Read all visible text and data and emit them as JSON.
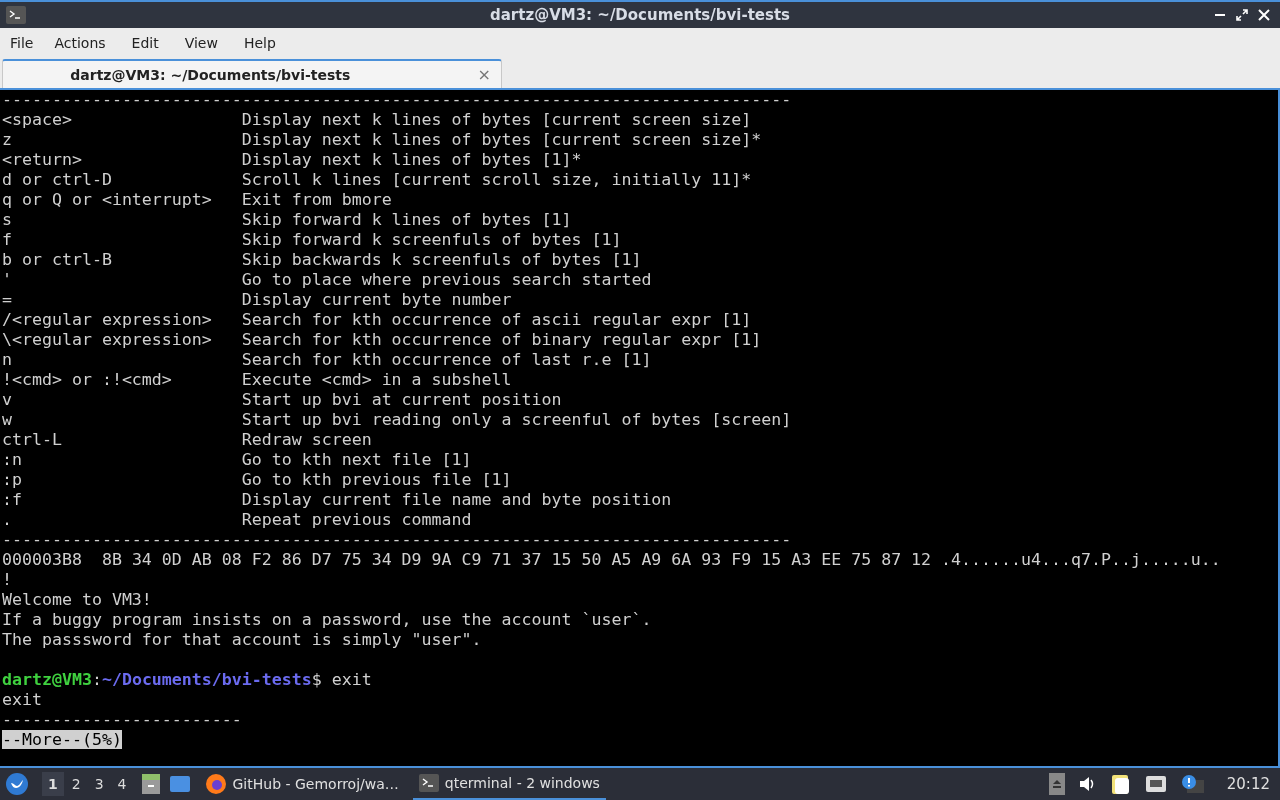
{
  "window": {
    "title": "dartz@VM3: ~/Documents/bvi-tests"
  },
  "menu": [
    "File",
    "Actions",
    "Edit",
    "View",
    "Help"
  ],
  "tabs": [
    {
      "label": "dartz@VM3: ~/Documents/bvi-tests",
      "selected": true,
      "close": "×"
    }
  ],
  "terminal": {
    "lines": [
      {
        "kind": "rule",
        "text": "-------------------------------------------------------------------------------"
      },
      {
        "kind": "help",
        "key": "<space>",
        "desc": "Display next k lines of bytes [current screen size]"
      },
      {
        "kind": "help",
        "key": "z",
        "desc": "Display next k lines of bytes [current screen size]*"
      },
      {
        "kind": "help",
        "key": "<return>",
        "desc": "Display next k lines of bytes [1]*"
      },
      {
        "kind": "help",
        "key": "d or ctrl-D",
        "desc": "Scroll k lines [current scroll size, initially 11]*"
      },
      {
        "kind": "help",
        "key": "q or Q or <interrupt>",
        "desc": "Exit from bmore"
      },
      {
        "kind": "help",
        "key": "s",
        "desc": "Skip forward k lines of bytes [1]"
      },
      {
        "kind": "help",
        "key": "f",
        "desc": "Skip forward k screenfuls of bytes [1]"
      },
      {
        "kind": "help",
        "key": "b or ctrl-B",
        "desc": "Skip backwards k screenfuls of bytes [1]"
      },
      {
        "kind": "help",
        "key": "'",
        "desc": "Go to place where previous search started"
      },
      {
        "kind": "help",
        "key": "=",
        "desc": "Display current byte number"
      },
      {
        "kind": "help",
        "key": "/<regular expression>",
        "desc": "Search for kth occurrence of ascii regular expr [1]"
      },
      {
        "kind": "help",
        "key": "\\<regular expression>",
        "desc": "Search for kth occurrence of binary regular expr [1]"
      },
      {
        "kind": "help",
        "key": "n",
        "desc": "Search for kth occurrence of last r.e [1]"
      },
      {
        "kind": "help",
        "key": "!<cmd> or :!<cmd>",
        "desc": "Execute <cmd> in a subshell"
      },
      {
        "kind": "help",
        "key": "v",
        "desc": "Start up bvi at current position"
      },
      {
        "kind": "help",
        "key": "w",
        "desc": "Start up bvi reading only a screenful of bytes [screen]"
      },
      {
        "kind": "help",
        "key": "ctrl-L",
        "desc": "Redraw screen"
      },
      {
        "kind": "help",
        "key": ":n",
        "desc": "Go to kth next file [1]"
      },
      {
        "kind": "help",
        "key": ":p",
        "desc": "Go to kth previous file [1]"
      },
      {
        "kind": "help",
        "key": ":f",
        "desc": "Display current file name and byte position"
      },
      {
        "kind": "help",
        "key": ".",
        "desc": "Repeat previous command"
      },
      {
        "kind": "rule",
        "text": "-------------------------------------------------------------------------------"
      },
      {
        "kind": "hex",
        "address": "000003B8",
        "bytes": "8B 34 0D AB 08 F2 86 D7 75 34 D9 9A C9 71 37 15 50 A5 A9 6A 93 F9 15 A3 EE 75 87 12",
        "ascii": ".4......u4...q7.P..j.....u.."
      },
      {
        "kind": "text",
        "text": "!"
      },
      {
        "kind": "text",
        "text": "Welcome to VM3!"
      },
      {
        "kind": "text",
        "text": "If a buggy program insists on a password, use the account `user`."
      },
      {
        "kind": "text",
        "text": "The passsword for that account is simply \"user\"."
      },
      {
        "kind": "blank"
      },
      {
        "kind": "prompt",
        "user": "dartz@VM3",
        "sep": ":",
        "path": "~/Documents/bvi-tests",
        "command": "$ exit"
      },
      {
        "kind": "text",
        "text": "exit"
      },
      {
        "kind": "rule",
        "text": "------------------------"
      },
      {
        "kind": "more",
        "text": "--More--(5%)"
      }
    ]
  },
  "taskbar": {
    "workspaces": [
      {
        "label": "1",
        "selected": true
      },
      {
        "label": "2",
        "selected": false
      },
      {
        "label": "3",
        "selected": false
      },
      {
        "label": "4",
        "selected": false
      }
    ],
    "tasks": [
      {
        "kind": "browser",
        "label": "GitHub - Gemorroj/wa…",
        "selected": false
      },
      {
        "kind": "terminal",
        "label": "qterminal - 2 windows",
        "selected": true
      }
    ],
    "clock": "20:12"
  }
}
